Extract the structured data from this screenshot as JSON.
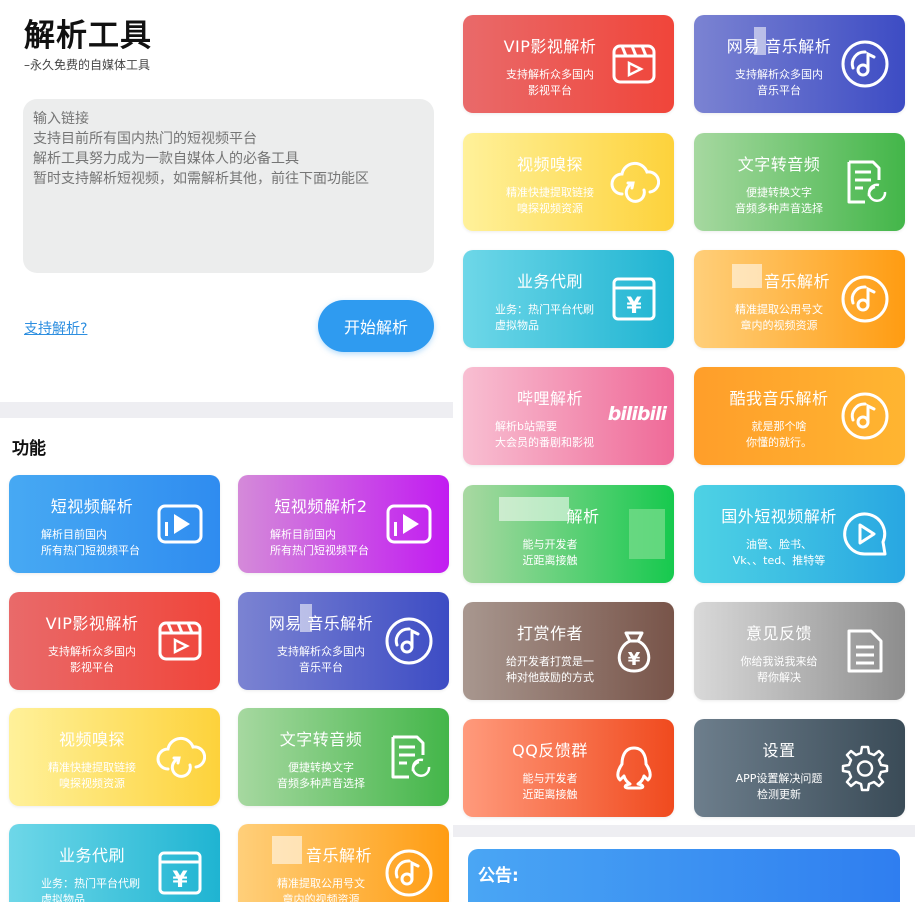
{
  "header": {
    "title": "解析工具",
    "subtitle": "–永久免费的自媒体工具"
  },
  "input": {
    "placeholder": "输入链接\n支持目前所有国内热门的短视频平台\n解析工具努力成为一款自媒体人的必备工具\n暂时支持解析短视频，如需解析其他，前往下面功能区"
  },
  "support_link": "支持解析?",
  "start_button": "开始解析",
  "functions_section": {
    "title": "功能",
    "cards": [
      {
        "title": "短视频解析",
        "desc": "解析目前国内\n所有热门短视频平台",
        "icon": "video-play-icon",
        "color": "#3a9ef2"
      },
      {
        "title": "短视频解析2",
        "desc": "解析目前国内\n所有热门短视频平台",
        "icon": "video-play-icon",
        "color": "#c930ee"
      },
      {
        "title": "VIP影视解析",
        "desc": "支持解析众多国内\n影视平台",
        "icon": "clapperboard-icon",
        "color": "#ef4c40"
      },
      {
        "title": "网易  音乐解析",
        "desc": "支持解析众多国内\n音乐平台",
        "icon": "music-disc-icon",
        "color": "#4050c5"
      },
      {
        "title": "视频嗅探",
        "desc": "精准快捷提取链接\n嗅探视频资源",
        "icon": "cloud-refresh-icon",
        "color": "#fdd43f"
      },
      {
        "title": "文字转音频",
        "desc": "便捷转换文字\n音频多种声音选择",
        "icon": "document-refresh-icon",
        "color": "#48b74e"
      },
      {
        "title": "业务代刷",
        "desc": "业务：热门平台代刷\n虚拟物品",
        "icon": "yuan-window-icon",
        "color": "#25b6d4"
      },
      {
        "title": "音乐解析",
        "desc": "精准提取公用号文\n章内的视频资源",
        "icon": "music-disc-icon",
        "color": "#ffa01a"
      }
    ]
  },
  "right_cards": [
    {
      "title": "VIP影视解析",
      "desc": "支持解析众多国内\n影视平台",
      "icon": "clapperboard-icon",
      "color": "#ef4c40"
    },
    {
      "title": "网易  音乐解析",
      "desc": "支持解析众多国内\n音乐平台",
      "icon": "music-disc-icon",
      "color": "#4050c5"
    },
    {
      "title": "视频嗅探",
      "desc": "精准快捷提取链接\n嗅探视频资源",
      "icon": "cloud-refresh-icon",
      "color": "#fdd43f"
    },
    {
      "title": "文字转音频",
      "desc": "便捷转换文字\n音频多种声音选择",
      "icon": "document-refresh-icon",
      "color": "#48b74e"
    },
    {
      "title": "业务代刷",
      "desc": "业务：热门平台代刷\n虚拟物品",
      "icon": "yuan-window-icon",
      "color": "#25b6d4"
    },
    {
      "title": "音乐解析",
      "desc": "精准提取公用号文\n章内的视频资源",
      "icon": "music-disc-icon",
      "color": "#ffa01a"
    },
    {
      "title": "哔哩解析",
      "desc": "解析b站需要\n大会员的番剧和影视",
      "icon": "bilibili-logo-icon",
      "logo_text": "bilibili",
      "color": "#ef6a98"
    },
    {
      "title": "酷我音乐解析",
      "desc": "就是那个啥\n你懂的就行。",
      "icon": "music-disc-icon",
      "color": "#ffa520"
    },
    {
      "title": "解析",
      "desc": "能与开发者\n近距离接触",
      "icon": "blurred-icon",
      "color": "#17c94f"
    },
    {
      "title": "国外短视频解析",
      "desc": "油管、脸书、\nVk、、ted、推特等",
      "icon": "play-bubble-icon",
      "color": "#29a9e2"
    },
    {
      "title": "打赏作者",
      "desc": "给开发者打赏是一\n种对他鼓励的方式",
      "icon": "money-bag-icon",
      "color": "#7a5649"
    },
    {
      "title": "意见反馈",
      "desc": "你给我说我来给\n帮你解决",
      "icon": "document-icon",
      "color": "#8e8e8e"
    },
    {
      "title": "QQ反馈群",
      "desc": "能与开发者\n近距离接触",
      "icon": "qq-penguin-icon",
      "color": "#f04c20"
    },
    {
      "title": "设置",
      "desc": "APP设置解决问题\n检测更新",
      "icon": "gear-icon",
      "color": "#3b4c58"
    }
  ],
  "notice": {
    "title": "公告:"
  }
}
